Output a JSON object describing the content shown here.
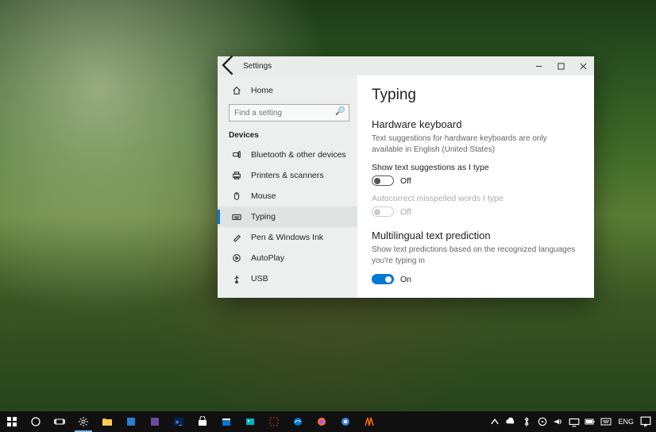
{
  "window": {
    "title": "Settings",
    "home_label": "Home",
    "search_placeholder": "Find a setting",
    "section_label": "Devices",
    "nav": [
      {
        "label": "Bluetooth & other devices"
      },
      {
        "label": "Printers & scanners"
      },
      {
        "label": "Mouse"
      },
      {
        "label": "Typing"
      },
      {
        "label": "Pen & Windows Ink"
      },
      {
        "label": "AutoPlay"
      },
      {
        "label": "USB"
      }
    ]
  },
  "page": {
    "title": "Typing",
    "hw_keyboard": {
      "title": "Hardware keyboard",
      "hint": "Text suggestions for hardware keyboards are only available in English (United States)",
      "suggestions": {
        "label": "Show text suggestions as I type",
        "state": "Off",
        "on": false
      },
      "autocorrect": {
        "label": "Autocorrect misspelled words I type",
        "state": "Off",
        "on": false,
        "disabled": true
      }
    },
    "multilingual": {
      "title": "Multilingual text prediction",
      "hint": "Show text predictions based on the recognized languages you're typing in",
      "toggle": {
        "state": "On",
        "on": true
      }
    }
  },
  "taskbar": {
    "lang": "ENG",
    "time": "",
    "search_tooltip": ""
  }
}
